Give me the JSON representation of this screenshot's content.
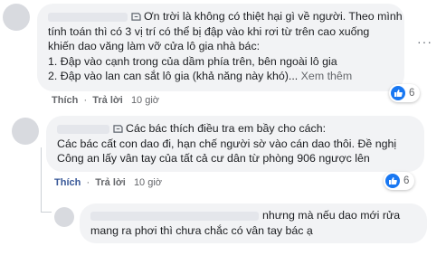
{
  "comments": [
    {
      "lines": [
        "Ơn trời là không có thiệt hại gì về người. Theo mình",
        "tính toán thì có 3 vị trí có thể bị đập vào khi rơi từ trên cao xuống",
        "khiến dao văng làm vỡ cửa lô gia nhà bác:",
        "1. Đập vào cạnh trong của dầm phía trên, bên ngoài lô gia",
        "2. Đập vào lan can sắt lô gia (khả năng này khó)..."
      ],
      "see_more": "Xem thêm",
      "reaction_count": "6",
      "like": "Thích",
      "reply": "Trả lời",
      "time": "10 giờ"
    },
    {
      "lines": [
        "Các bác thích điều tra em bầy cho cách:",
        "Các bác cất con dao đi, hạn chế người sờ vào cán dao thôi. Đề nghị",
        "Công an lấy vân tay của tất cả cư dân từ phòng 906 ngược lên"
      ],
      "reaction_count": "6",
      "like": "Thích",
      "reply": "Trả lời",
      "time": "10 giờ"
    },
    {
      "lines": [
        "nhưng mà nếu dao mới rửa",
        "mang ra phơi thì chưa chắc có vân tay bác ạ"
      ]
    }
  ],
  "icons": {
    "reaction": "like-thumb-icon",
    "sticker": "emoji-sticker-icon",
    "menu": "more-options-icon"
  },
  "colors": {
    "like_blue": "#1877f2",
    "bubble_bg": "#f2f3f5",
    "link_blue": "#385898"
  }
}
